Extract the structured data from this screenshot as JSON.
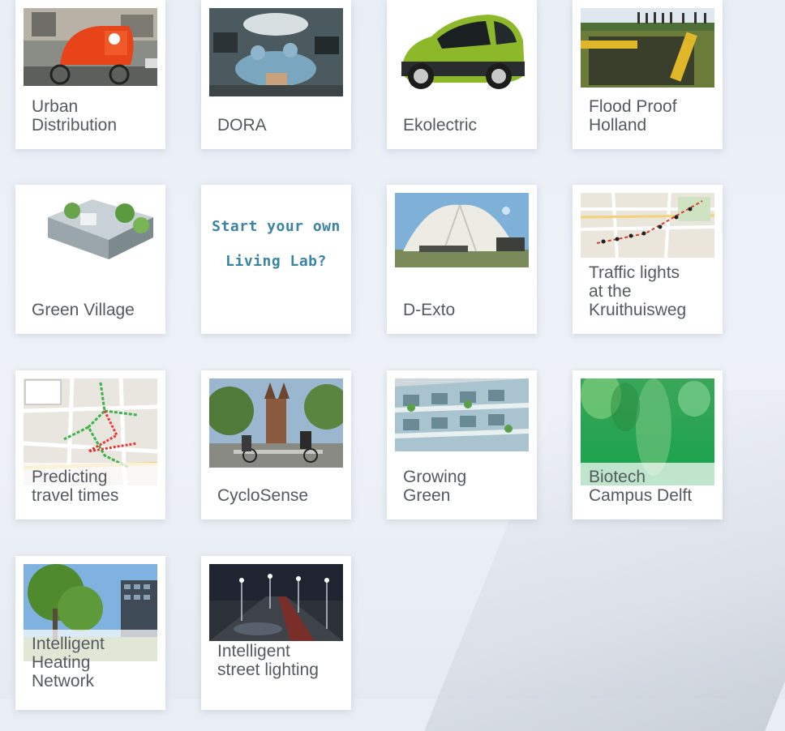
{
  "tiles": [
    {
      "id": "urban-distribution",
      "label": "Urban\nDistribution",
      "image": "cargo-bike-photo"
    },
    {
      "id": "dora",
      "label": "DORA",
      "image": "operating-room-photo"
    },
    {
      "id": "ekolectric",
      "label": "Ekolectric",
      "image": "green-smart-car-photo"
    },
    {
      "id": "flood-proof-holland",
      "label": "Flood Proof\nHolland",
      "image": "flood-barrier-photo"
    },
    {
      "id": "green-village",
      "label": "Green Village",
      "image": "village-model-render"
    },
    {
      "id": "living-lab",
      "label": "Start your own\nLiving Lab?"
    },
    {
      "id": "d-exto",
      "label": "D-Exto",
      "image": "tent-pavilion-photo"
    },
    {
      "id": "traffic-lights",
      "label": "Traffic lights\nat the\nKruithuisweg",
      "image": "traffic-map-image"
    },
    {
      "id": "predicting-travel-times",
      "label": "Predicting\ntravel times",
      "image": "travel-times-map-image"
    },
    {
      "id": "cyclosense",
      "label": "CycloSense",
      "image": "cyclists-photo"
    },
    {
      "id": "growing-green",
      "label": "Growing\nGreen",
      "image": "green-building-photo"
    },
    {
      "id": "biotech-campus-delft",
      "label": "Biotech\nCampus Delft",
      "image": "green-capsules-image"
    },
    {
      "id": "intelligent-heating-network",
      "label": "Intelligent\nHeating\nNetwork",
      "image": "trees-building-photo"
    },
    {
      "id": "intelligent-street-lighting",
      "label": "Intelligent\nstreet lighting",
      "image": "street-lights-photo"
    }
  ]
}
